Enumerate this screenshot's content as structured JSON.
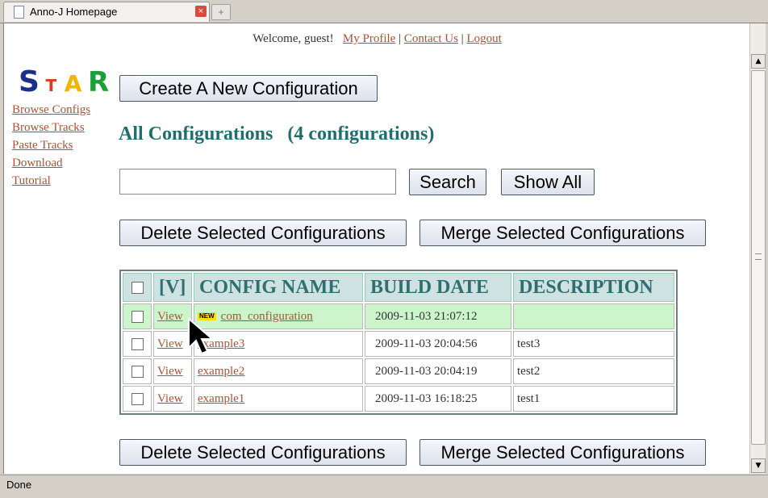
{
  "browser": {
    "tab_title": "Anno-J Homepage",
    "tab_close": "×",
    "new_tab": "+",
    "status": "Done"
  },
  "topnav": {
    "welcome": "Welcome, guest!",
    "my_profile": "My Profile",
    "separator": "|",
    "contact_us": "Contact Us",
    "logout": "Logout"
  },
  "logo": {
    "letters": [
      {
        "char": "S",
        "color": "#1c2f8a"
      },
      {
        "char": "T",
        "color": "#e03a1e"
      },
      {
        "char": "A",
        "color": "#f2b400"
      },
      {
        "char": "R",
        "color": "#1aa037"
      }
    ]
  },
  "sidenav": {
    "items": [
      "Browse Configs",
      "Browse Tracks",
      "Paste Tracks",
      "Download",
      "Tutorial"
    ]
  },
  "main": {
    "create_button": "Create A New Configuration",
    "heading": "All Configurations   (4 configurations)",
    "search_value": "",
    "search_button": "Search",
    "show_all_button": "Show All",
    "delete_button": "Delete Selected Configurations",
    "merge_button": "Merge Selected Configurations"
  },
  "table": {
    "headers": [
      "[V]",
      "CONFIG NAME",
      "BUILD DATE",
      "DESCRIPTION"
    ],
    "new_badge": "NEW",
    "rows": [
      {
        "view": "View",
        "name": "com_configuration",
        "date": "2009-11-03 21:07:12",
        "description": "",
        "is_new": true
      },
      {
        "view": "View",
        "name": "example3",
        "date": "2009-11-03 20:04:56",
        "description": "test3",
        "is_new": false
      },
      {
        "view": "View",
        "name": "example2",
        "date": "2009-11-03 20:04:19",
        "description": "test2",
        "is_new": false
      },
      {
        "view": "View",
        "name": "example1",
        "date": "2009-11-03 16:18:25",
        "description": "test1",
        "is_new": false
      }
    ]
  },
  "colors": {
    "link": "#b0502e",
    "heading": "#1f6e6e",
    "highlight_row": "#ccf5cc",
    "table_header_bg": "#cfe2e2"
  }
}
